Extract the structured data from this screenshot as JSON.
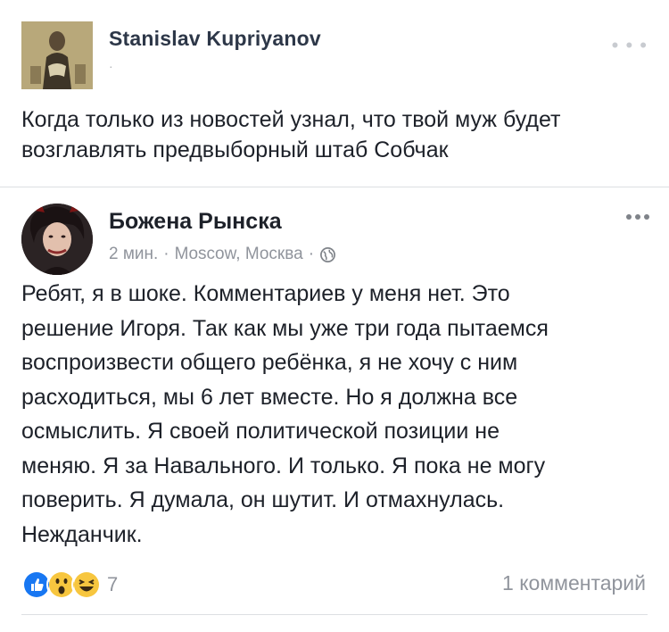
{
  "outer_post": {
    "author": "Stanislav Kupriyanov",
    "meta": "·",
    "more": "• • •",
    "text": "Когда только из новостей узнал, что твой муж будет возглавлять предвыборный штаб Собчак"
  },
  "shared_post": {
    "author": "Божена Рынска",
    "time": "2 мин.",
    "separator1": "·",
    "location": "Moscow, Москва",
    "separator2": "·",
    "privacy_icon": "globe-icon",
    "text": "Ребят, я в шоке. Комментариев у меня нет. Это\nрешение Игоря. Так как мы уже три года пытаемся\nвоспроизвести общего ребёнка, я не хочу с ним\nрасходиться, мы 6 лет вместе. Но я должна все\nосмыслить. Я своей политической позиции не\nменяю. Я за Навального. И только. Я пока не могу\nповерить. Я думала, он шутит. И отмахнулась.\nНежданчик.",
    "reactions": {
      "icons": [
        "like-icon",
        "wow-icon",
        "haha-icon"
      ],
      "count": "7"
    },
    "comments": "1 комментарий"
  },
  "colors": {
    "like": "#1877f2",
    "emoji_yellow": "#f7c63f",
    "meta_gray": "#90949c"
  }
}
